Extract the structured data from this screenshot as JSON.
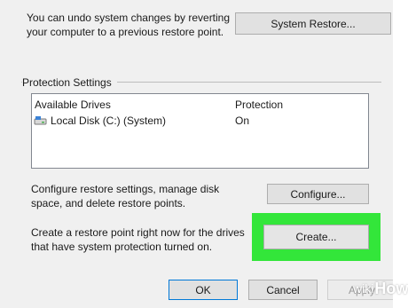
{
  "restore": {
    "description": "You can undo system changes by reverting your computer to a previous restore point.",
    "button_label": "System Restore..."
  },
  "protection": {
    "group_title": "Protection Settings",
    "columns": [
      "Available Drives",
      "Protection"
    ],
    "drives": [
      {
        "name": "Local Disk (C:) (System)",
        "protection": "On",
        "icon": "hard-drive-icon"
      }
    ]
  },
  "configure": {
    "description": "Configure restore settings, manage disk space, and delete restore points.",
    "button_label": "Configure..."
  },
  "create": {
    "description": "Create a restore point right now for the drives that have system protection turned on.",
    "button_label": "Create...",
    "highlight_color": "#33e63a"
  },
  "footer": {
    "ok_label": "OK",
    "cancel_label": "Cancel",
    "apply_label": "Apply"
  },
  "watermark": {
    "prefix": "wiki",
    "suffix": "How"
  }
}
